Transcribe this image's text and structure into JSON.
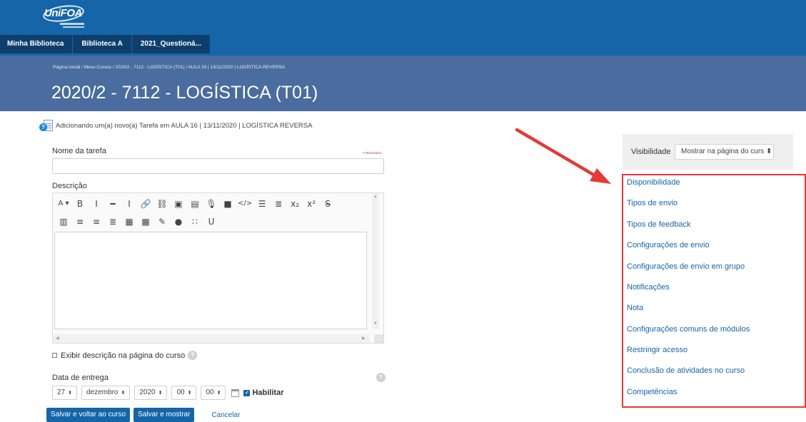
{
  "brand": {
    "logo_text": "UniFOA"
  },
  "nav": {
    "tabs": [
      {
        "label": "Minha Biblioteca"
      },
      {
        "label": "Biblioteca A"
      },
      {
        "label": "2021_Questioná..."
      }
    ]
  },
  "header": {
    "breadcrumb": "Página inicial  /  Meus Cursos  /  2020/2 - 7112 - LOGÍSTICA (T01)  /  AULA 16 | 13/11/2020 | LOGÍSTICA REVERSA",
    "title": "2020/2 - 7112 - LOGÍSTICA (T01)"
  },
  "form": {
    "adding_text": "Adicionando um(a) novo(a) Tarefa em AULA 16 | 13/11/2020 | LOGÍSTICA REVERSA",
    "name_label": "Nome da tarefa",
    "required_note": "# Necessário",
    "name_value": "",
    "description_label": "Descrição",
    "show_description_label": "Exibir descrição na página do curso",
    "due_date_label": "Data de entrega",
    "due_date": {
      "day": "27",
      "month": "dezembro",
      "year": "2020",
      "hour": "00",
      "minute": "00",
      "enable_label": "Habilitar",
      "enabled": true
    },
    "buttons": {
      "save_return": "Salvar e voltar ao curso",
      "save_show": "Salvar e mostrar",
      "cancel": "Cancelar"
    }
  },
  "editor": {
    "toolbar_row1": [
      {
        "icon": "font-style-icon",
        "glyph": "A ▾"
      },
      {
        "icon": "bold-icon",
        "glyph": "B"
      },
      {
        "icon": "italic-icon",
        "glyph": "I"
      },
      {
        "icon": "horizontal-rule-icon",
        "glyph": "━"
      },
      {
        "icon": "text-cursor-icon",
        "glyph": "Ⅰ"
      },
      {
        "icon": "link-icon",
        "glyph": "🔗"
      },
      {
        "icon": "unlink-icon",
        "glyph": "⛓"
      },
      {
        "icon": "image-icon",
        "glyph": "▣"
      },
      {
        "icon": "media-icon",
        "glyph": "▤"
      },
      {
        "icon": "microphone-icon",
        "glyph": "🎙"
      },
      {
        "icon": "video-icon",
        "glyph": "■"
      },
      {
        "icon": "code-icon",
        "glyph": "</>"
      },
      {
        "icon": "unordered-list-icon",
        "glyph": "☰"
      },
      {
        "icon": "ordered-list-icon",
        "glyph": "≣"
      },
      {
        "icon": "subscript-icon",
        "glyph": "x₂"
      },
      {
        "icon": "superscript-icon",
        "glyph": "x²"
      },
      {
        "icon": "strikethrough-icon",
        "glyph": "S̶"
      }
    ],
    "toolbar_row2": [
      {
        "icon": "align-left-icon",
        "glyph": "▥"
      },
      {
        "icon": "align-center-icon",
        "glyph": "≡"
      },
      {
        "icon": "align-right-icon",
        "glyph": "≡"
      },
      {
        "icon": "justify-icon",
        "glyph": "≣"
      },
      {
        "icon": "table-icon",
        "glyph": "▦"
      },
      {
        "icon": "calculator-icon",
        "glyph": "▩"
      },
      {
        "icon": "edit-icon",
        "glyph": "✎"
      },
      {
        "icon": "accessibility-icon",
        "glyph": "●"
      },
      {
        "icon": "special-chars-icon",
        "glyph": "∷"
      },
      {
        "icon": "underline-icon",
        "glyph": "U"
      }
    ]
  },
  "sidebar": {
    "visibility_label": "Visibilidade",
    "visibility_value": "Mostrar na página do curs ⬍",
    "sections": [
      {
        "label": "Disponibilidade"
      },
      {
        "label": "Tipos de envio"
      },
      {
        "label": "Tipos de feedback"
      },
      {
        "label": "Configurações de envio"
      },
      {
        "label": "Configurações de envio em grupo"
      },
      {
        "label": "Notificações"
      },
      {
        "label": "Nota"
      },
      {
        "label": "Configurações comuns de módulos"
      },
      {
        "label": "Restringir acesso"
      },
      {
        "label": "Conclusão de atividades no curso"
      },
      {
        "label": "Competências"
      }
    ]
  },
  "annotation": {
    "arrow_color": "#e53935",
    "highlight_color": "#e53935"
  }
}
